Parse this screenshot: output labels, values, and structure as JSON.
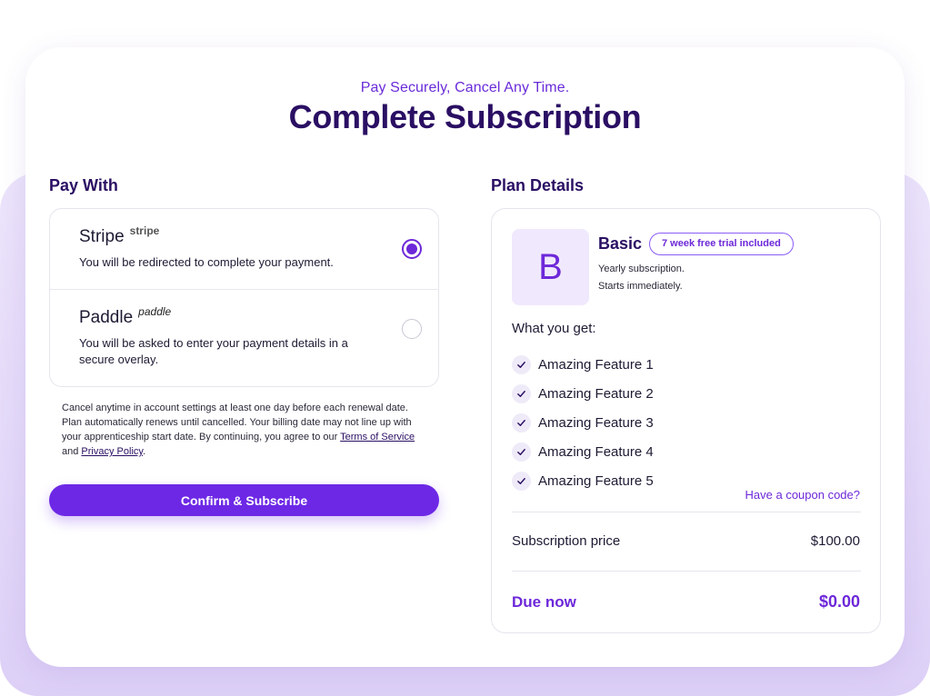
{
  "header": {
    "eyebrow": "Pay Securely, Cancel Any Time.",
    "title": "Complete Subscription"
  },
  "pay_with": {
    "heading": "Pay With",
    "methods": [
      {
        "name": "Stripe",
        "brand_mark": "stripe",
        "description": "You will be redirected to complete your payment.",
        "selected": true
      },
      {
        "name": "Paddle",
        "brand_mark": "paddle",
        "description": "You will be asked to enter your payment details in a secure overlay.",
        "selected": false
      }
    ],
    "legal": {
      "text": "Cancel anytime in account settings at least one day before each renewal date. Plan automatically renews until cancelled. Your billing date may not line up with your apprenticeship start date. By continuing, you agree to our",
      "terms_link": "Terms of Service",
      "conjunction": "and",
      "privacy_link": "Privacy Policy",
      "end": "."
    },
    "confirm_button": "Confirm & Subscribe"
  },
  "plan_details": {
    "heading": "Plan Details",
    "avatar_letter": "B",
    "plan_name": "Basic",
    "trial_badge": "7 week free trial included",
    "meta": [
      "Yearly subscription.",
      "Starts immediately."
    ],
    "what_you_get": "What you get:",
    "features": [
      "Amazing Feature 1",
      "Amazing Feature 2",
      "Amazing Feature 3",
      "Amazing Feature 4",
      "Amazing Feature 5"
    ],
    "coupon_link": "Have a coupon code?",
    "subscription_price_label": "Subscription price",
    "subscription_price": "$100.00",
    "due_now_label": "Due now",
    "due_now": "$0.00"
  },
  "colors": {
    "accent": "#6d28d9",
    "button": "#6d28e6",
    "heading": "#2a0f63",
    "backdrop": "#e4d9f9"
  },
  "icons": {
    "feature_check": "check-icon",
    "selected_radio": "radio-selected-icon",
    "unselected_radio": "radio-unselected-icon"
  }
}
